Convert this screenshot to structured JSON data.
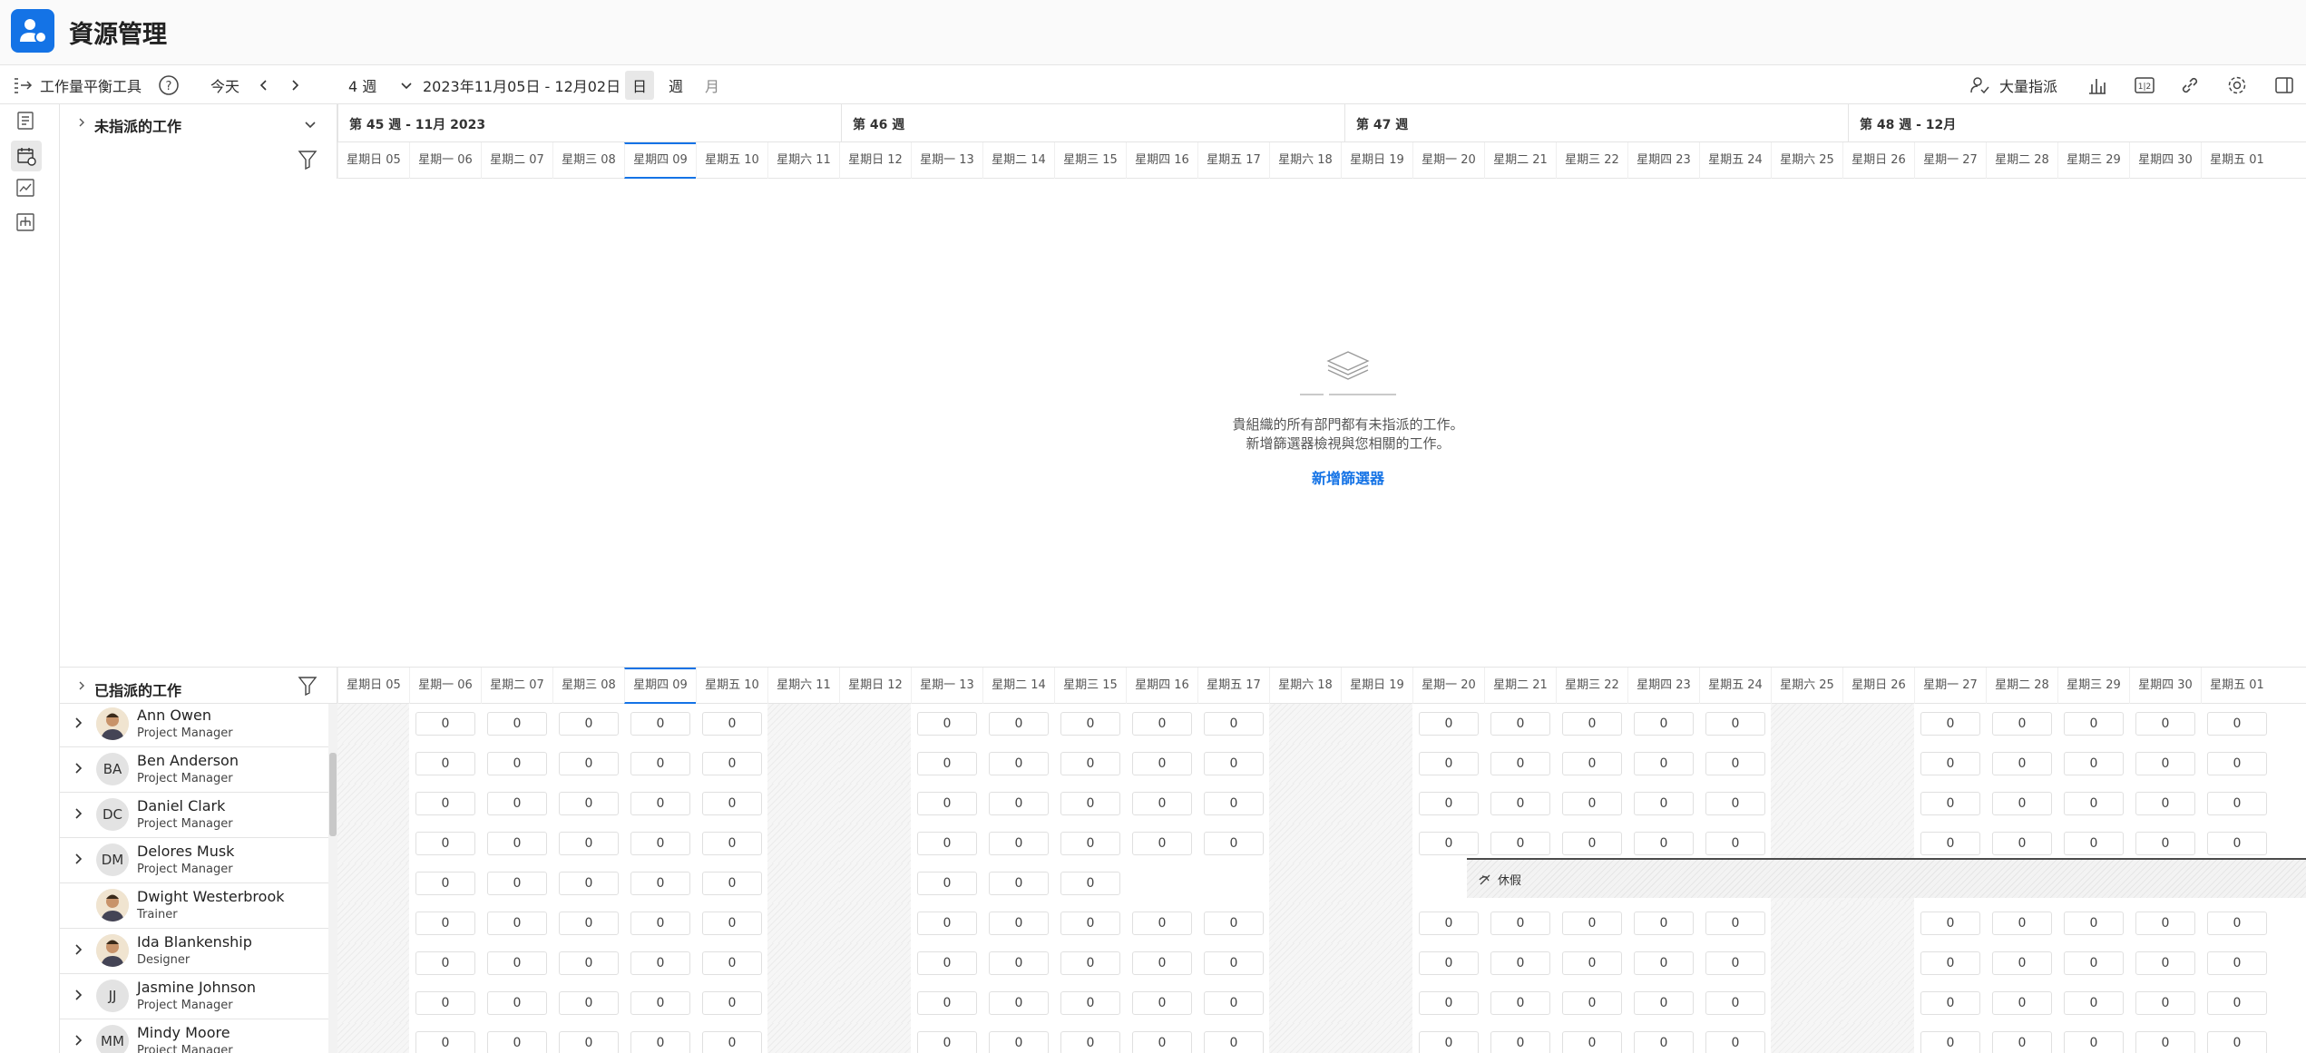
{
  "app": {
    "title": "資源管理"
  },
  "toolbar": {
    "tool_name": "工作量平衡工具",
    "today": "今天",
    "range": "4 週",
    "date_range": "2023年11月05日 - 12月02日",
    "view_day": "日",
    "view_week": "週",
    "view_month": "月",
    "bulk_assign": "大量指派"
  },
  "unassigned": {
    "title": "未指派的工作"
  },
  "assigned": {
    "title": "已指派的工作"
  },
  "weeks": [
    "第 45 週 - 11月 2023",
    "第 46 週",
    "第 47 週",
    "第 48 週 - 12月"
  ],
  "days": [
    "星期日 05",
    "星期一 06",
    "星期二 07",
    "星期三 08",
    "星期四 09",
    "星期五 10",
    "星期六 11",
    "星期日 12",
    "星期一 13",
    "星期二 14",
    "星期三 15",
    "星期四 16",
    "星期五 17",
    "星期六 18",
    "星期日 19",
    "星期一 20",
    "星期二 21",
    "星期三 22",
    "星期四 23",
    "星期五 24",
    "星期六 25",
    "星期日 26",
    "星期一 27",
    "星期二 28",
    "星期三 29",
    "星期四 30",
    "星期五 01"
  ],
  "empty_state": {
    "line1": "貴組織的所有部門都有未指派的工作。",
    "line2": "新增篩選器檢視與您相關的工作。",
    "link": "新增篩選器"
  },
  "users": [
    {
      "name": "Ann Owen",
      "role": "Project Manager",
      "initials": "",
      "photo": true
    },
    {
      "name": "Ben  Anderson",
      "role": "Project Manager",
      "initials": "BA",
      "photo": false
    },
    {
      "name": "Daniel Clark",
      "role": "Project Manager",
      "initials": "DC",
      "photo": false
    },
    {
      "name": "Delores Musk",
      "role": "Project Manager",
      "initials": "DM",
      "photo": false
    },
    {
      "name": "Dwight Westerbrook",
      "role": "Trainer",
      "initials": "",
      "photo": true
    },
    {
      "name": "Ida Blankenship",
      "role": "Designer",
      "initials": "",
      "photo": true
    },
    {
      "name": "Jasmine Johnson",
      "role": "Project Manager",
      "initials": "JJ",
      "photo": false
    },
    {
      "name": "Mindy Moore",
      "role": "Project Manager",
      "initials": "MM",
      "photo": false
    }
  ],
  "cell_value": "0",
  "time_off": {
    "label": "休假"
  },
  "colors": {
    "accent": "#1473e6"
  }
}
